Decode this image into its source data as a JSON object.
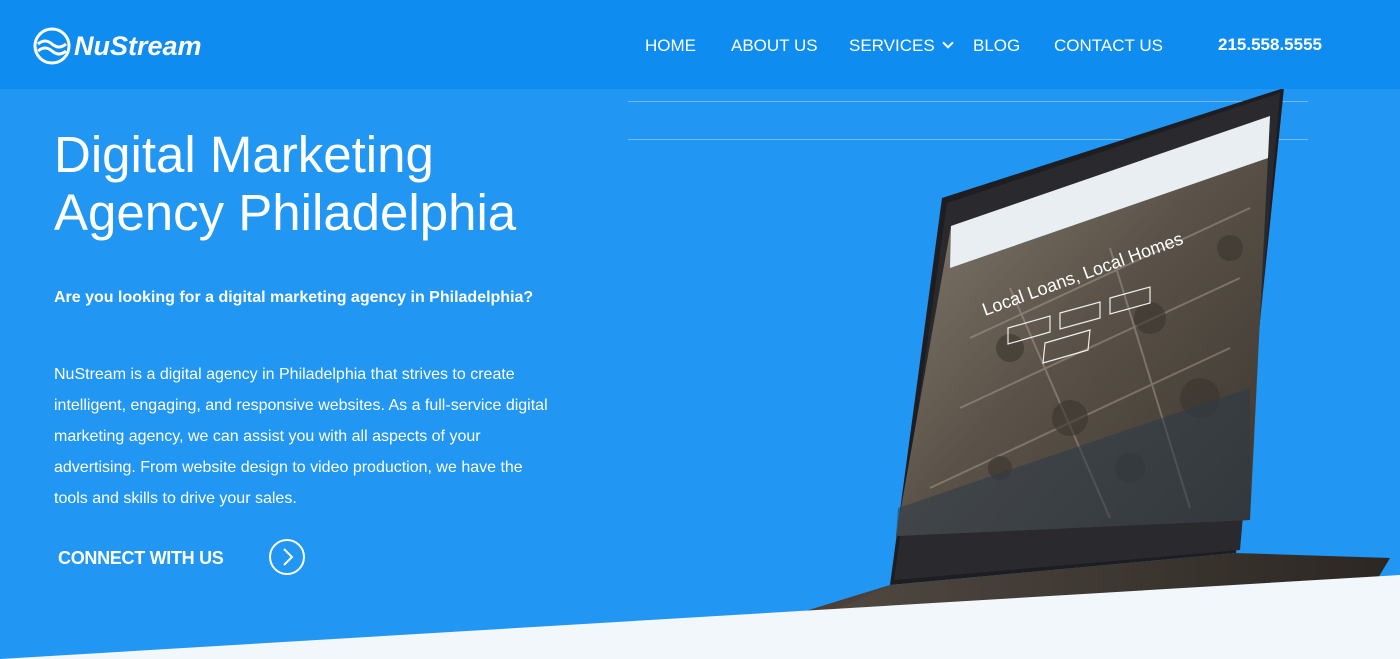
{
  "brand": {
    "name": "NuStream"
  },
  "nav": {
    "items": [
      {
        "label": "HOME"
      },
      {
        "label": "ABOUT US"
      },
      {
        "label": "SERVICES"
      },
      {
        "label": "BLOG"
      },
      {
        "label": "CONTACT US"
      }
    ],
    "phone": "215.558.5555"
  },
  "hero": {
    "headline_line1": "Digital Marketing",
    "headline_line2": "Agency Philadelphia",
    "question": "Are you looking for a digital marketing agency in Philadelphia?",
    "body_lines": [
      "NuStream is a digital agency in Philadelphia that strives to create",
      "intelligent, engaging, and responsive websites. As a full-service digital",
      "marketing agency, we can assist you with all aspects of your",
      "advertising. From website design to video production, we have the",
      "tools and skills to drive your sales."
    ],
    "cta_label": "CONNECT WITH US"
  },
  "laptop_screen": {
    "tagline": "Local Loans, Local Homes"
  },
  "colors": {
    "header_bg": "#0e8cf0",
    "hero_bg": "#2196f3",
    "text": "#ffffff",
    "floor": "#f2f7fb"
  },
  "icons": [
    "nustream-logo-icon",
    "chevron-down-icon",
    "arrow-circle-right-icon"
  ]
}
